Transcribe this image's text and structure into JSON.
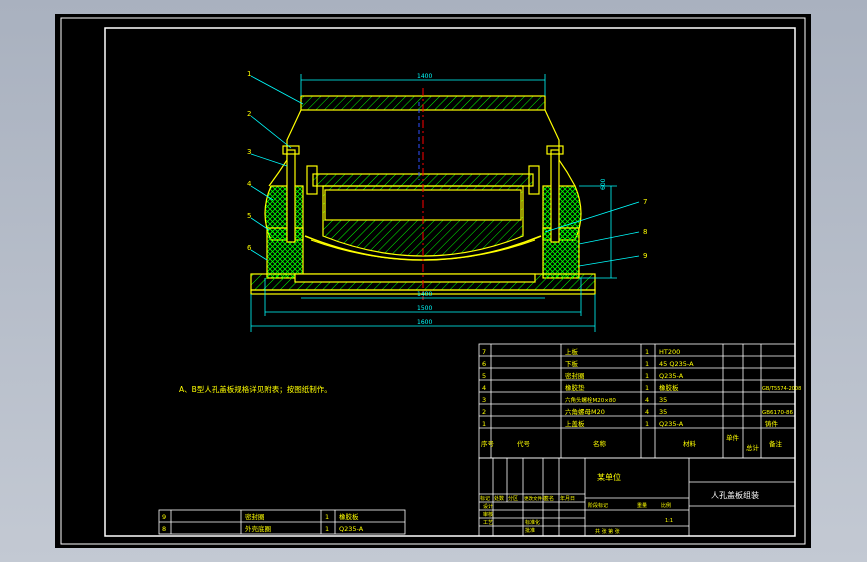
{
  "drawing": {
    "dimensions": {
      "top_width": "1400",
      "bottom_width_inner": "1400",
      "base_inner": "1500",
      "base_outer": "1600",
      "height": "600"
    },
    "part_callouts": [
      "1",
      "2",
      "3",
      "4",
      "5",
      "6",
      "7",
      "8",
      "9"
    ],
    "note": "A、B型人孔盖板规格详见附表；按图纸制作。",
    "colors": {
      "frame": "#ffffff",
      "part": "#ffff00",
      "dimension": "#00ffff",
      "hatch": "#00ff00",
      "centerline_red": "#ff0000",
      "centerline_blue": "#3050ff",
      "table": "#ffffff",
      "table_text": "#ffff00"
    }
  },
  "bom": {
    "rows": [
      {
        "no": "7",
        "name": "上板",
        "qty": "1",
        "material": "HT200",
        "weight": "",
        "note": ""
      },
      {
        "no": "6",
        "name": "下板",
        "qty": "1",
        "material": "45 Q235-A",
        "weight": "",
        "note": ""
      },
      {
        "no": "5",
        "name": "密封圈",
        "qty": "1",
        "material": "Q235-A",
        "weight": "",
        "note": ""
      },
      {
        "no": "4",
        "name": "橡胶垫",
        "qty": "1",
        "material": "橡胶板",
        "weight": "",
        "note": "GB/T5574-2008"
      },
      {
        "no": "3",
        "name": "六角头螺栓M20×80",
        "qty": "4",
        "material": "35",
        "weight": "",
        "note": ""
      },
      {
        "no": "2",
        "name": "六角螺母M20",
        "qty": "4",
        "material": "35",
        "weight": "",
        "note": "GB6170-86"
      },
      {
        "no": "1",
        "name": "上盖板",
        "qty": "1",
        "material": "Q235-A",
        "weight": "",
        "note": "铸件"
      }
    ],
    "header": {
      "no": "序号",
      "code": "代号",
      "name": "名称",
      "qty": "数量",
      "material": "材料",
      "weight": "单件",
      "total": "总计",
      "note": "备注"
    }
  },
  "title_block": {
    "drawing_title": "人孔盖板组装",
    "company": "某单位",
    "labels": [
      "标记",
      "处数",
      "分区",
      "更改文件号",
      "签名",
      "年月日"
    ],
    "roles": [
      "设计",
      "审核",
      "工艺",
      "标准化",
      "批准"
    ],
    "stage_labels": [
      "阶段标记",
      "重量",
      "比例"
    ],
    "scale": "1:1",
    "sheet": "共 张 第 张"
  },
  "lower_table": {
    "rows": [
      {
        "no": "9",
        "name": "密封圈",
        "qty": "1",
        "material": "橡胶板"
      },
      {
        "no": "8",
        "name": "外壳底圈",
        "qty": "1",
        "material": "Q235-A"
      }
    ]
  }
}
